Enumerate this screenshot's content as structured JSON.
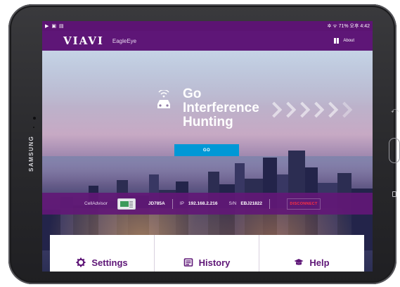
{
  "device": {
    "brand": "SAMSUNG"
  },
  "statusbar": {
    "left_icons": [
      "play-icon",
      "image-icon",
      "gallery-icon"
    ],
    "right_text": "✲ ᯤ 71% 오후 4:42"
  },
  "appbar": {
    "logo": "VIAVI",
    "product": "EagleEye",
    "about_label": "About"
  },
  "hero": {
    "headline_line1": "Go",
    "headline_line2": "Interference",
    "headline_line3": "Hunting",
    "go_label": "GO"
  },
  "connection": {
    "label": "CellAdvisor",
    "model": "JD785A",
    "ip_label": "IP",
    "ip": "192.168.2.216",
    "sn_label": "S/N",
    "sn": "EBJ21822",
    "disconnect_label": "DISCONNECT"
  },
  "tiles": {
    "settings_label": "Settings",
    "history_label": "History",
    "help_label": "Help"
  },
  "colors": {
    "brand_purple": "#5e1677",
    "go_blue": "#0098d6",
    "disconnect_red": "#ff3040"
  }
}
